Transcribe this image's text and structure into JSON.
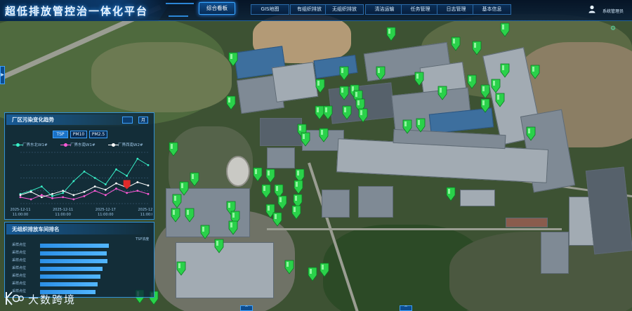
{
  "header": {
    "app_title": "超低排放管控治一体化平台",
    "nav": [
      {
        "label": "综合看板",
        "active": true
      },
      {
        "label": "GIS地图",
        "active": false
      },
      {
        "label": "有组织排放",
        "active": false
      },
      {
        "label": "无组织排放",
        "active": false
      },
      {
        "label": "清洁运输",
        "active": false
      },
      {
        "label": "任务管理",
        "active": false
      },
      {
        "label": "日志管理",
        "active": false
      },
      {
        "label": "基本信息",
        "active": false
      }
    ],
    "user": {
      "name": "系统管理员",
      "icon": "user-icon"
    }
  },
  "trend_panel": {
    "title": "厂区污染变化趋势",
    "period_button": "月",
    "pollutant_tabs": [
      {
        "label": "TSP",
        "active": true
      },
      {
        "label": "PM10",
        "active": false
      },
      {
        "label": "PM2.5",
        "active": false
      }
    ],
    "legend": [
      {
        "label": "厂界东北W1#",
        "color": "#38f0c8"
      },
      {
        "label": "厂界东南W1#",
        "color": "#ff5ad8"
      },
      {
        "label": "厂界西南W2#",
        "color": "#ffffff"
      }
    ]
  },
  "chart_data": {
    "type": "line",
    "title": "厂区污染变化趋势",
    "x": [
      "2025-12-11",
      "2025-12-11",
      "2025-12-17",
      "2025-12-20"
    ],
    "x_tick_sub": [
      "11:00:00",
      "11:00:00",
      "11:00:00",
      "11:00:00"
    ],
    "series": [
      {
        "name": "厂界东北W1#",
        "color": "#38f0c8",
        "values": [
          45,
          60,
          80,
          35,
          50,
          105,
          150,
          120,
          90,
          160,
          130,
          210,
          180
        ]
      },
      {
        "name": "厂界东南W1#",
        "color": "#ff5ad8",
        "values": [
          30,
          20,
          40,
          25,
          30,
          20,
          35,
          60,
          40,
          70,
          50,
          60,
          45
        ]
      },
      {
        "name": "厂界西南W2#",
        "color": "#ffffff",
        "values": [
          40,
          55,
          30,
          45,
          60,
          40,
          55,
          80,
          65,
          95,
          75,
          100,
          85
        ]
      }
    ],
    "highlight_color": "#e02a2a",
    "ylim": [
      0,
      240
    ],
    "grid": true,
    "legend_position": "top"
  },
  "rank_panel": {
    "title": "无组织排放车间排名",
    "unit_label": "TSP浓度",
    "rows": [
      {
        "label": "采样点位",
        "value": 0.82
      },
      {
        "label": "采样点位",
        "value": 0.79
      },
      {
        "label": "采样点位",
        "value": 0.8
      },
      {
        "label": "采样点位",
        "value": 0.74
      },
      {
        "label": "采样点位",
        "value": 0.72
      },
      {
        "label": "采样点位",
        "value": 0.68
      },
      {
        "label": "采样点位",
        "value": 0.66
      }
    ]
  },
  "logo": {
    "mark": "K",
    "text": "大数跨境"
  },
  "colors": {
    "accent": "#2f8fd6",
    "pin": "#2ad14a",
    "highlight": "#e02a2a"
  }
}
